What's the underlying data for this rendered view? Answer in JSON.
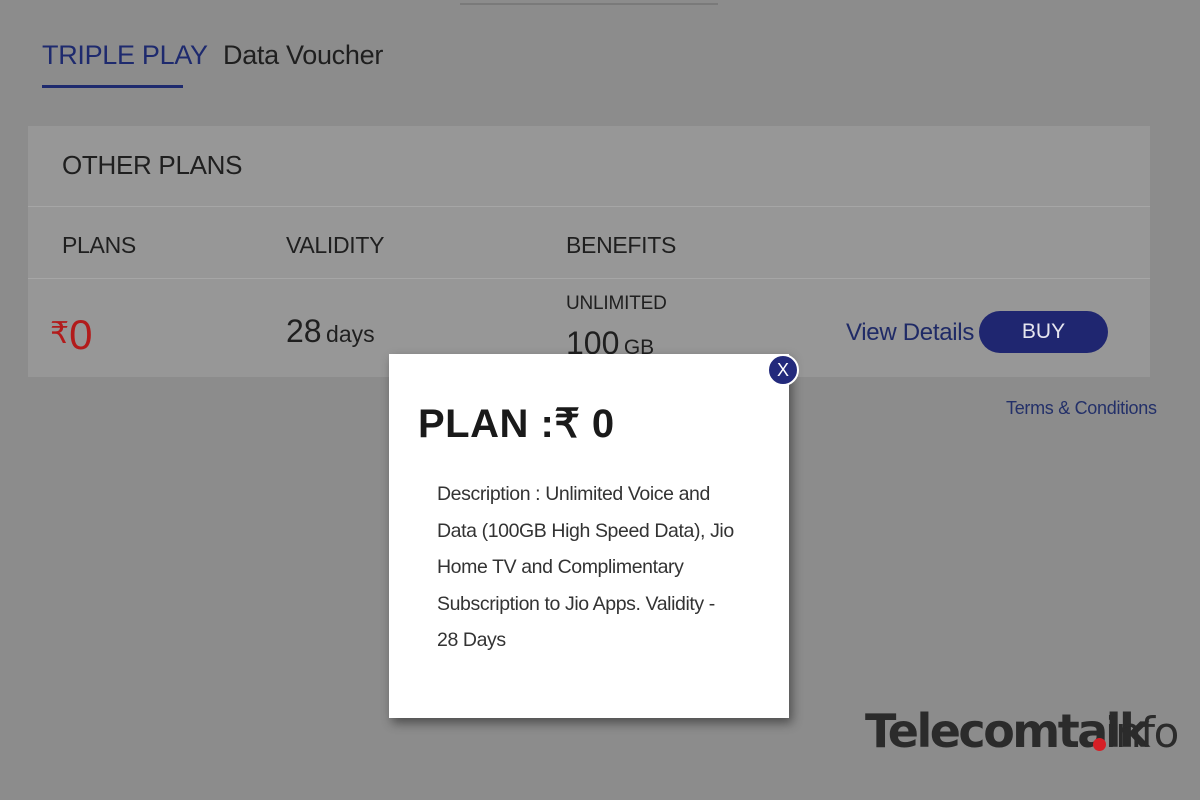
{
  "tabs": [
    {
      "label": "TRIPLE PLAY",
      "active": true
    },
    {
      "label": "Data Voucher",
      "active": false
    }
  ],
  "plans_card": {
    "title": "OTHER PLANS",
    "columns": [
      "PLANS",
      "VALIDITY",
      "BENEFITS"
    ],
    "row": {
      "currency": "₹",
      "price": "0",
      "validity_value": "28",
      "validity_unit": "days",
      "benefit_label": "UNLIMITED",
      "benefit_value": "100",
      "benefit_unit": "GB",
      "view_details": "View Details",
      "buy": "BUY"
    }
  },
  "terms": "Terms & Conditions",
  "modal": {
    "title": "PLAN :₹ 0",
    "description_lines": [
      "Description : Unlimited Voice and",
      "Data (100GB High Speed Data), Jio",
      "Home TV and Complimentary",
      "Subscription to Jio Apps. Validity -",
      "28 Days"
    ],
    "close": "X"
  },
  "watermark": {
    "main": "Telecomtalk",
    "suffix": "info"
  },
  "colors": {
    "accent": "#1f2670",
    "price": "#b21b1b",
    "overlay_bg": "#8c8c8c",
    "watermark_dot": "#d61f26"
  }
}
